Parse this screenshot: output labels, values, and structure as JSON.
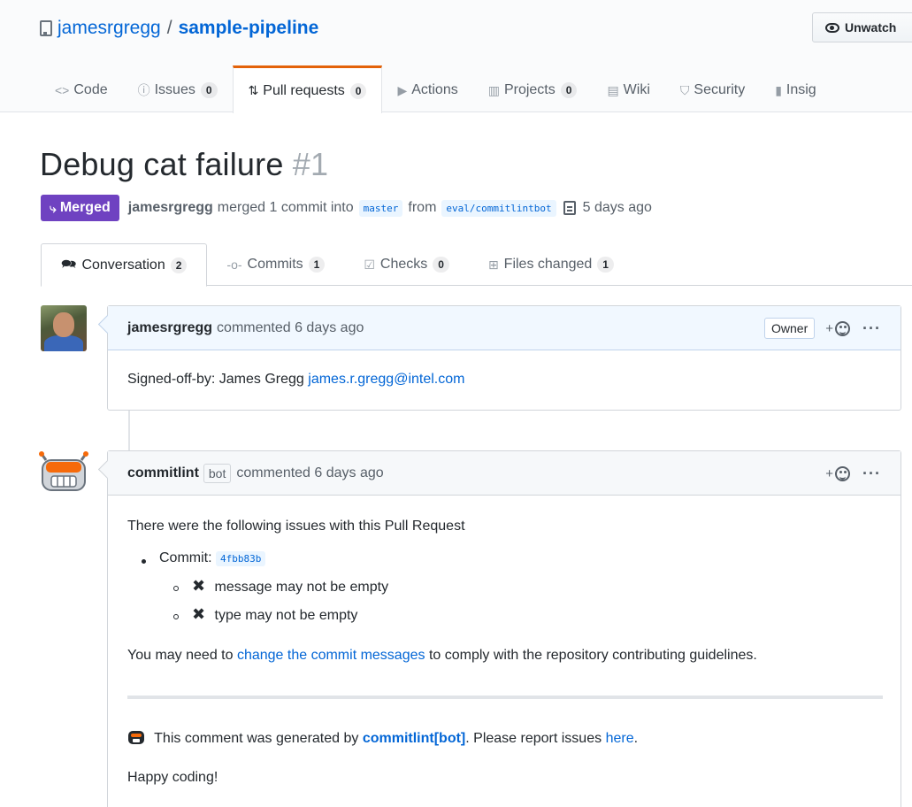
{
  "repo": {
    "owner": "jamesrgregg",
    "separator": "/",
    "name": "sample-pipeline",
    "watch_label": "Unwatch"
  },
  "reponav": [
    {
      "label": "Code",
      "icon": "code-icon",
      "counter": null
    },
    {
      "label": "Issues",
      "icon": "issue-icon",
      "counter": "0"
    },
    {
      "label": "Pull requests",
      "icon": "pull-request-icon",
      "counter": "0"
    },
    {
      "label": "Actions",
      "icon": "play-icon",
      "counter": null
    },
    {
      "label": "Projects",
      "icon": "project-icon",
      "counter": "0"
    },
    {
      "label": "Wiki",
      "icon": "book-icon",
      "counter": null
    },
    {
      "label": "Security",
      "icon": "shield-icon",
      "counter": null
    },
    {
      "label": "Insig",
      "icon": "graph-icon",
      "counter": null
    }
  ],
  "pr": {
    "title": "Debug cat failure",
    "number": "#1",
    "state": "Merged",
    "author": "jamesrgregg",
    "merged_text": "merged 1 commit into",
    "base_branch": "master",
    "from_text": "from",
    "head_branch": "eval/commitlintbot",
    "time": "5 days ago"
  },
  "prtabs": [
    {
      "label": "Conversation",
      "counter": "2",
      "icon": "comment-discussion-icon"
    },
    {
      "label": "Commits",
      "counter": "1",
      "icon": "git-commit-icon"
    },
    {
      "label": "Checks",
      "counter": "0",
      "icon": "checklist-icon"
    },
    {
      "label": "Files changed",
      "counter": "1",
      "icon": "diff-icon"
    }
  ],
  "comments": [
    {
      "author": "jamesrgregg",
      "action": "commented 6 days ago",
      "owner_label": "Owner",
      "reaction_plus": "+",
      "more": "···",
      "body_prefix": "Signed-off-by: James Gregg",
      "body_email": "james.r.gregg@intel.com"
    },
    {
      "author": "commitlint",
      "bot_label": "bot",
      "action": "commented 6 days ago",
      "reaction_plus": "+",
      "more": "···",
      "intro": "There were the following issues with this Pull Request",
      "commit_label": "Commit:",
      "commit_sha": "4fbb83b",
      "issues": [
        "message may not be empty",
        "type may not be empty"
      ],
      "xmark": "✖",
      "advice_prefix": "You may need to",
      "advice_link": "change the commit messages",
      "advice_suffix": "to comply with the repository contributing guidelines.",
      "footer_prefix": "This comment was generated by",
      "footer_link": "commitlint[bot]",
      "footer_mid": ". Please report issues",
      "footer_here": "here",
      "footer_end": ".",
      "signoff": "Happy coding!"
    }
  ],
  "colors": {
    "merged": "#6f42c1",
    "link": "#0366d6",
    "active_tab_border": "#e36209"
  }
}
